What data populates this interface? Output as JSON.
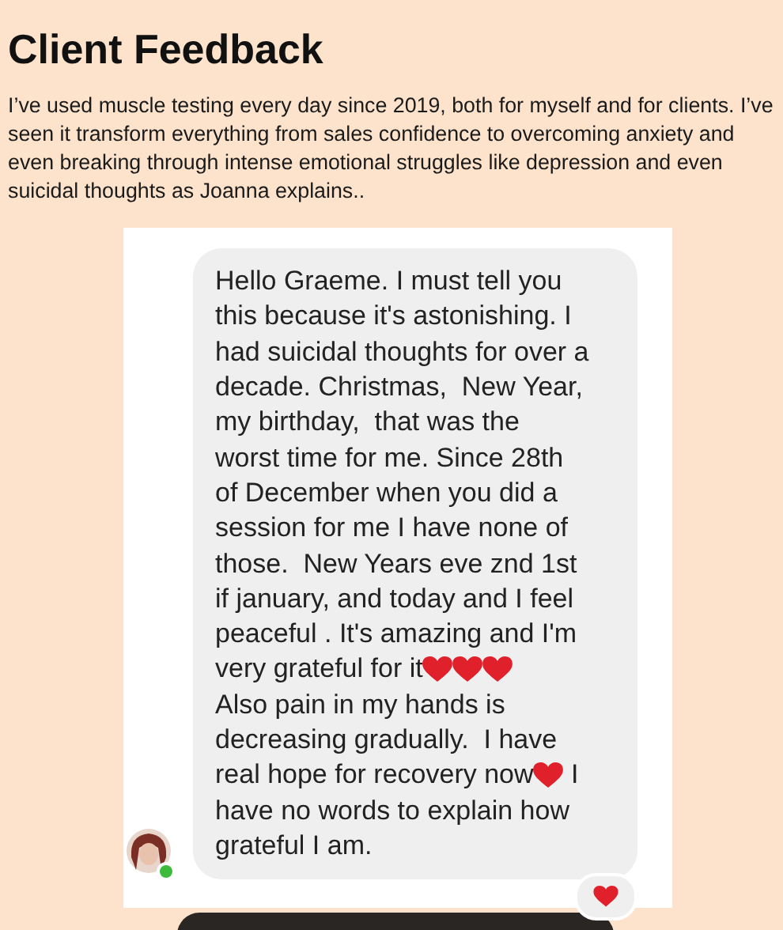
{
  "heading": "Client Feedback",
  "intro": "I’ve used muscle testing every day since 2019, both for myself and for clients. I’ve seen it transform everything from sales confidence to overcoming anxiety and even breaking through intense emotional struggles like depression and even suicidal thoughts as Joanna explains..",
  "screenshot": {
    "message_lines": [
      [
        {
          "kind": "text",
          "text": "Hello Graeme. I must tell you"
        }
      ],
      [
        {
          "kind": "text",
          "text": "this because it's astonishing. I"
        }
      ],
      [
        {
          "kind": "text",
          "text": "had suicidal thoughts for over a"
        }
      ],
      [
        {
          "kind": "text",
          "text": "decade. Christmas,  New Year,"
        }
      ],
      [
        {
          "kind": "text",
          "text": "my birthday,  that was the"
        }
      ],
      [
        {
          "kind": "text",
          "text": "worst time for me. Since 28th"
        }
      ],
      [
        {
          "kind": "text",
          "text": "of December when you did a"
        }
      ],
      [
        {
          "kind": "text",
          "text": "session for me I have none of"
        }
      ],
      [
        {
          "kind": "text",
          "text": "those.  New Years eve znd 1st"
        }
      ],
      [
        {
          "kind": "text",
          "text": "if january, and today and I feel"
        }
      ],
      [
        {
          "kind": "text",
          "text": "peaceful . It's amazing and I'm"
        }
      ],
      [
        {
          "kind": "text",
          "text": "very grateful for it"
        },
        {
          "kind": "heart"
        },
        {
          "kind": "heart"
        },
        {
          "kind": "heart"
        }
      ],
      [
        {
          "kind": "text",
          "text": "Also pain in my hands is"
        }
      ],
      [
        {
          "kind": "text",
          "text": "decreasing gradually.  I have"
        }
      ],
      [
        {
          "kind": "text",
          "text": "real hope for recovery now"
        },
        {
          "kind": "heart"
        },
        {
          "kind": "text",
          "text": " I"
        }
      ],
      [
        {
          "kind": "text",
          "text": "have no words to explain how"
        }
      ],
      [
        {
          "kind": "text",
          "text": "grateful I am."
        }
      ]
    ],
    "sender_online": true,
    "reaction": {
      "kind": "heart"
    }
  }
}
